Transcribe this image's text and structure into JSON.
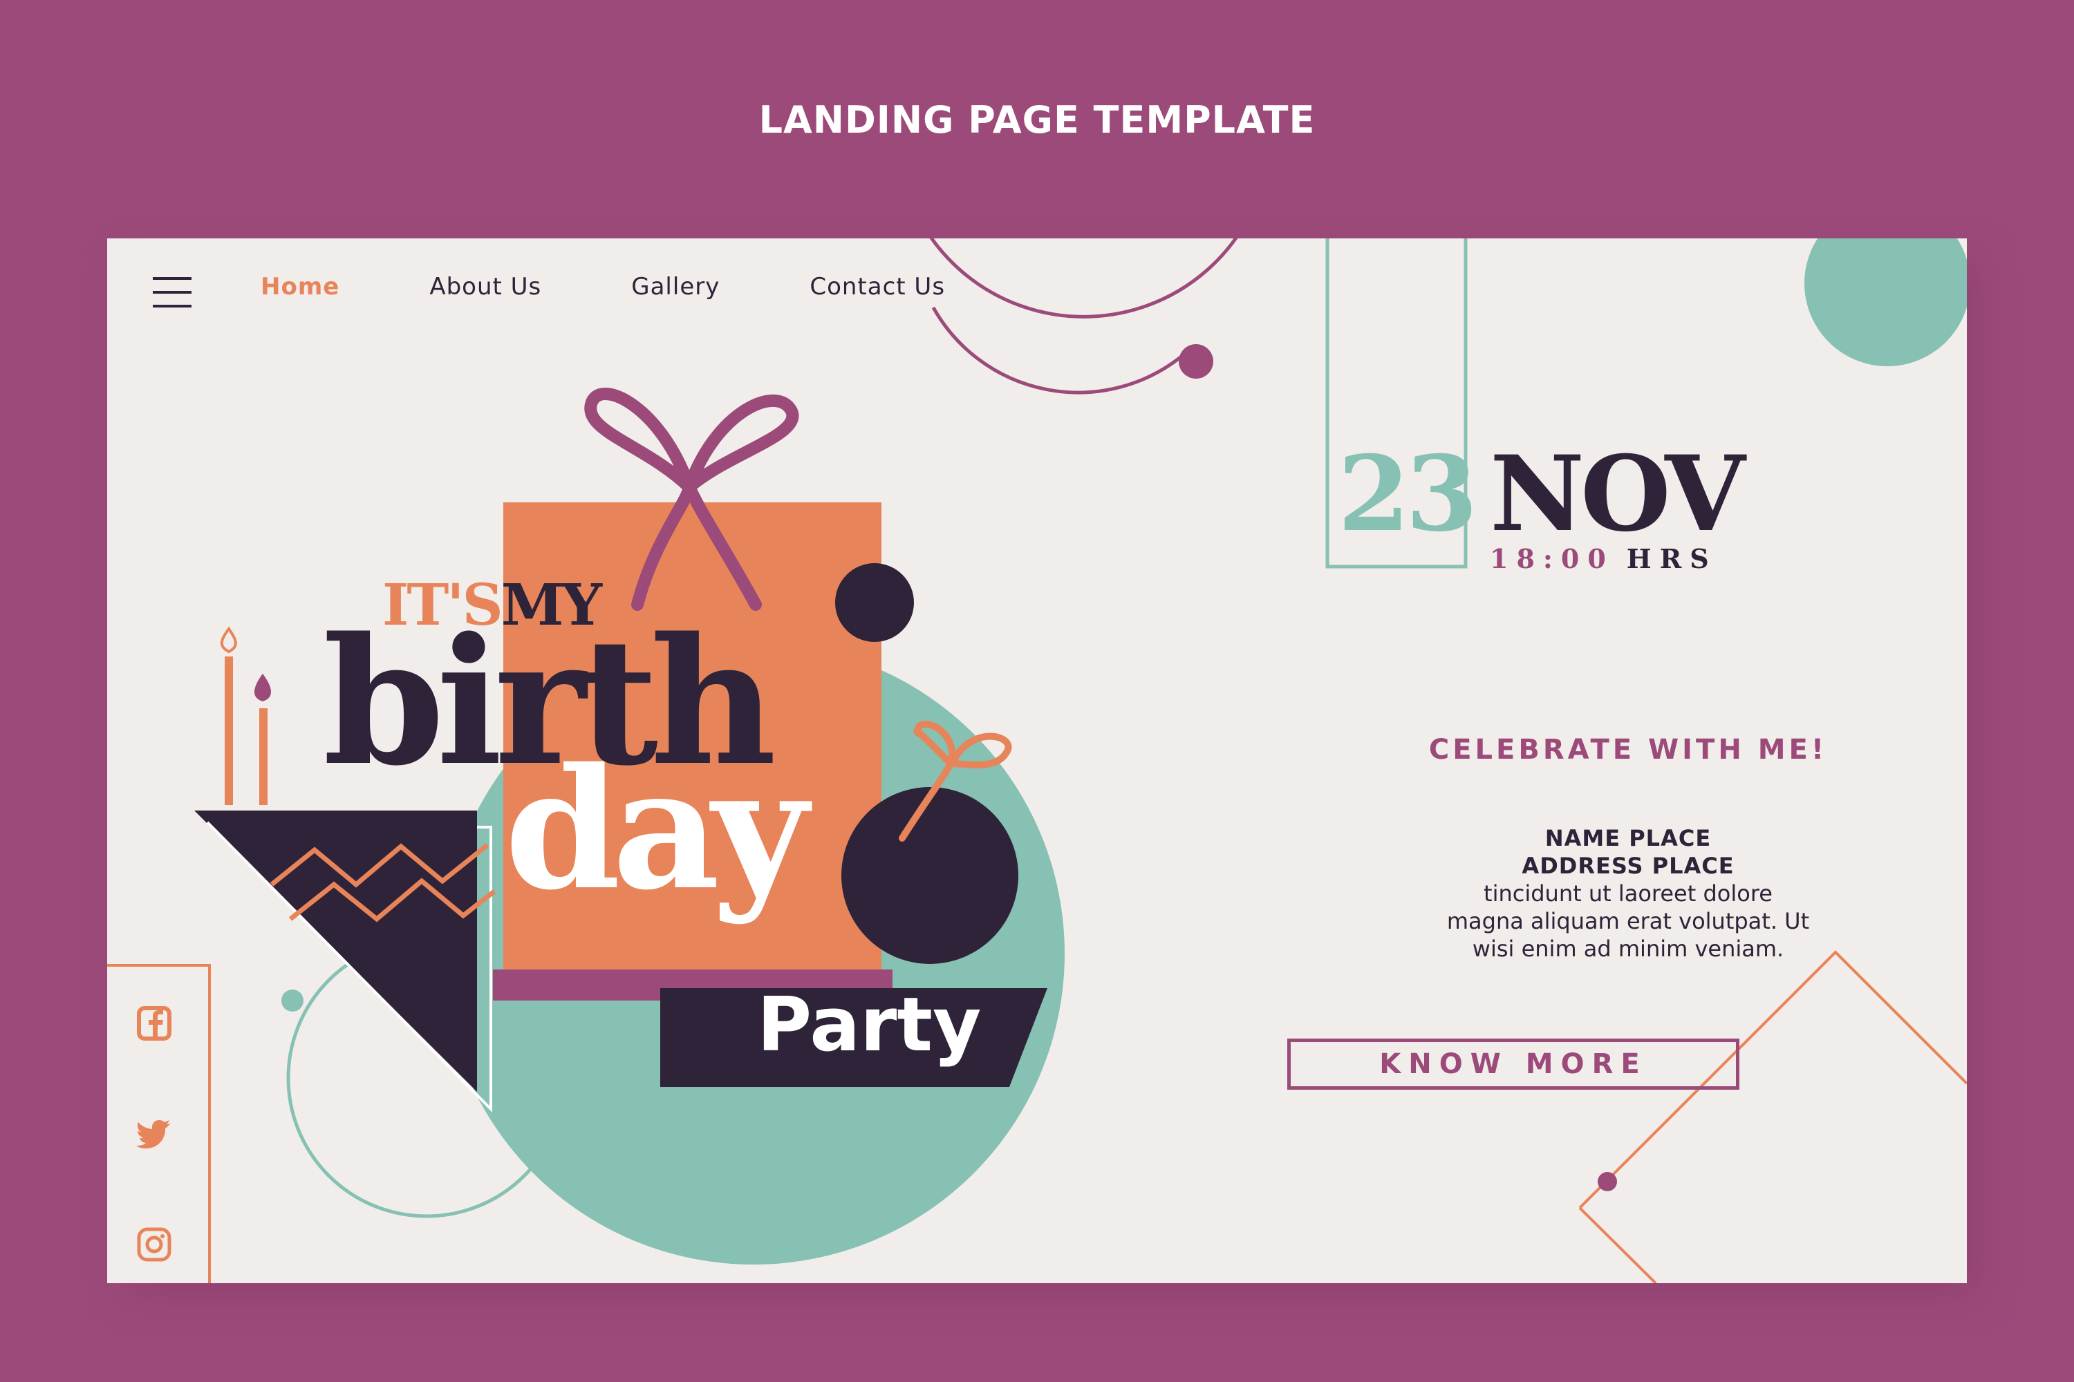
{
  "page_heading": "LANDING PAGE TEMPLATE",
  "nav": {
    "items": [
      "Home",
      "About Us",
      "Gallery",
      "Contact Us"
    ],
    "active": "Home"
  },
  "hero": {
    "its": "IT'S",
    "my": "MY",
    "birth": "birth",
    "day": "day",
    "party": "Party"
  },
  "event": {
    "day": "23",
    "month": "NOV",
    "time": "18:00",
    "time_unit": "HRS"
  },
  "celebrate": "CELEBRATE WITH ME!",
  "info": {
    "name": "NAME PLACE",
    "address": "ADDRESS PLACE",
    "lines": [
      "tincidunt ut laoreet dolore",
      "magna aliquam erat volutpat. Ut",
      "wisi enim ad minim veniam."
    ]
  },
  "cta_label": "KNOW MORE",
  "social_icons": [
    "facebook-icon",
    "twitter-icon",
    "instagram-icon"
  ],
  "colors": {
    "background": "#9c4a7a",
    "card": "#f1edea",
    "orange": "#e8845a",
    "teal": "#86c1b3",
    "dark": "#2e2338",
    "plum": "#9c4a7a"
  }
}
